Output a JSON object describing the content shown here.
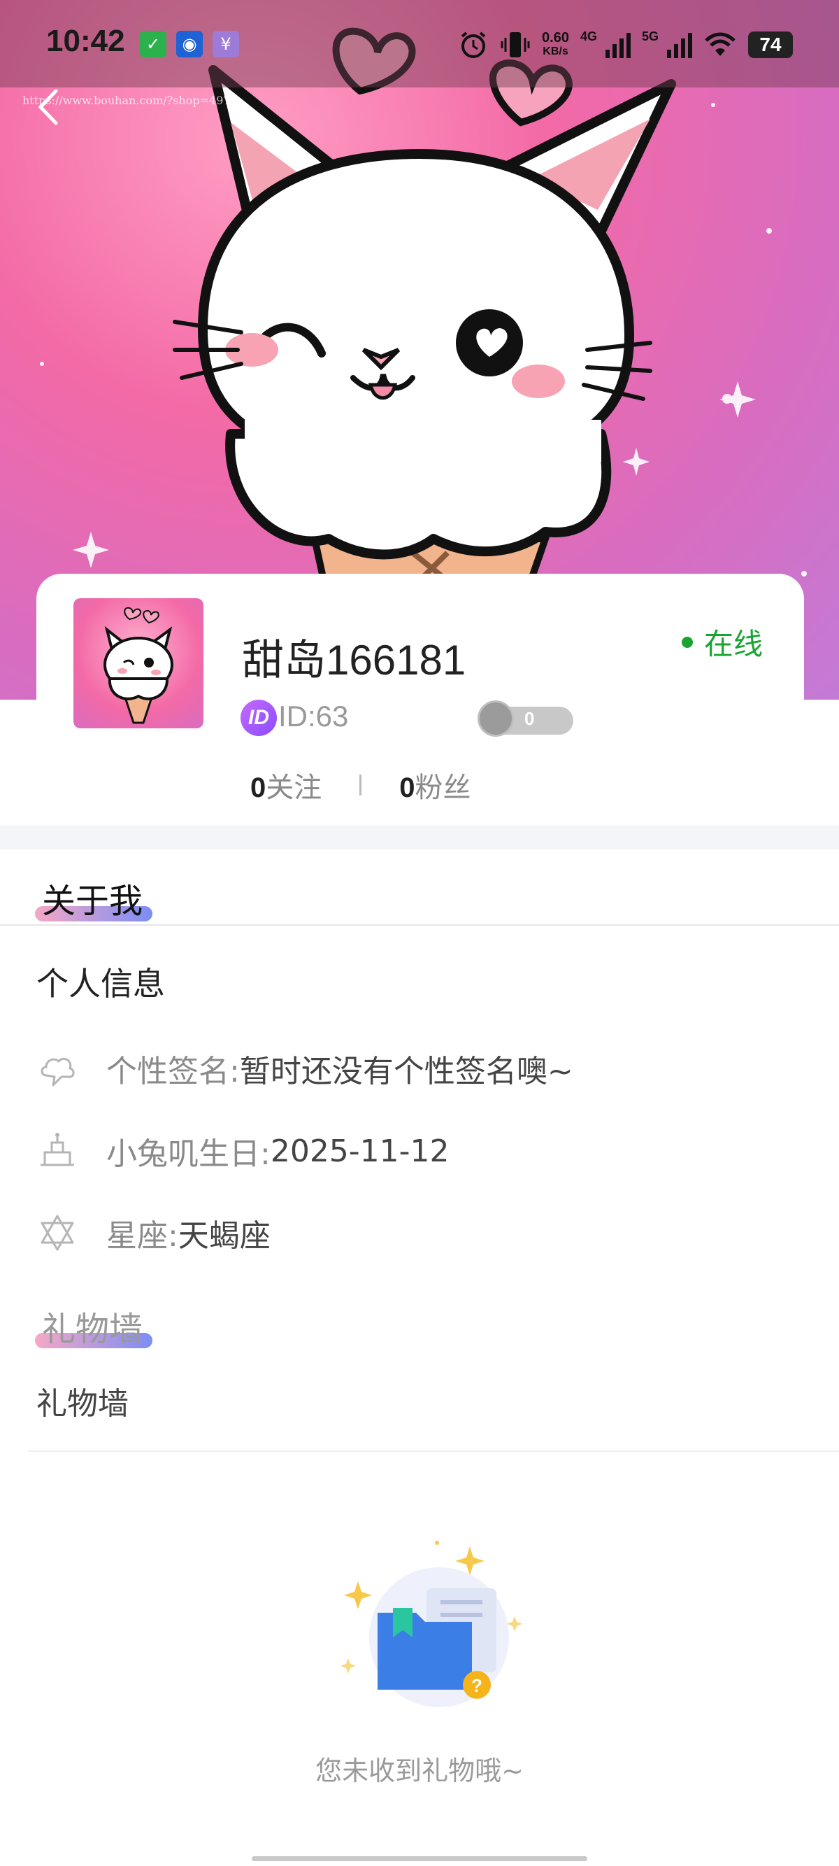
{
  "status_bar": {
    "time": "10:42",
    "net_speed_value": "0.60",
    "net_speed_unit": "KB/s",
    "signal_1_label": "4G",
    "signal_2_label": "5G",
    "battery": "74",
    "app_icons": [
      "check-app-icon",
      "browser-app-icon",
      "yen-app-icon"
    ]
  },
  "header": {
    "watermark": "https://www.bouhan.com/?shop=4970"
  },
  "profile": {
    "nickname": "甜岛166181",
    "online_status": "在线",
    "id_badge": "ID",
    "id_text": "ID:63",
    "level_value": "0",
    "following_count": "0",
    "following_label": "关注",
    "followers_count": "0",
    "followers_label": "粉丝"
  },
  "about": {
    "section_title": "关于我",
    "personal_info_title": "个人信息",
    "rows": [
      {
        "label": "个性签名:",
        "value": "暂时还没有个性签名噢~",
        "icon": "cloud-icon"
      },
      {
        "label": "小兔叽生日:",
        "value": "2025-11-12",
        "icon": "cake-icon"
      },
      {
        "label": "星座:",
        "value": "天蝎座",
        "icon": "star-of-david-icon"
      }
    ]
  },
  "gift_wall": {
    "section_title": "礼物墙",
    "label": "礼物墙",
    "empty_text": "您未收到礼物哦~"
  },
  "colors": {
    "online_green": "#1aa332",
    "underline_start": "#f6a8c5",
    "underline_end": "#7b8df5",
    "hero_pink": "#f36aa6"
  }
}
